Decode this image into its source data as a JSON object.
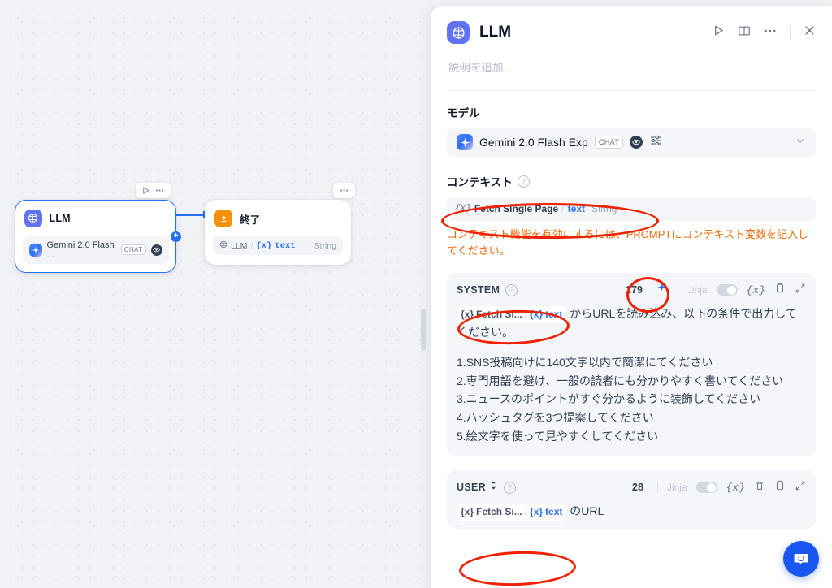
{
  "canvas": {
    "node_toolbar_llm": {
      "run_icon": "play-icon",
      "more_icon": "ellipsis-icon"
    },
    "node_toolbar_end": {
      "more_icon": "ellipsis-icon"
    },
    "nodes": [
      {
        "id": "llm",
        "title": "LLM",
        "badge_icon": "llm-node-icon",
        "selected": true,
        "model": {
          "name": "Gemini 2.0 Flash ...",
          "tag": "CHAT",
          "vision_icon": "eye-icon"
        }
      },
      {
        "id": "end",
        "title": "終了",
        "badge_icon": "end-node-icon",
        "selected": false,
        "variable": {
          "source_icon": "llm-inline-icon",
          "source": "LLM",
          "separator": "/",
          "var_prefix": "{x}",
          "var_name": "text",
          "type": "String"
        }
      }
    ]
  },
  "panel": {
    "header": {
      "badge_icon": "llm-node-icon",
      "title": "LLM",
      "actions": [
        {
          "name": "run-icon",
          "glyph": "play"
        },
        {
          "name": "help-book-icon",
          "glyph": "book"
        },
        {
          "name": "more-icon",
          "glyph": "ellipsis"
        },
        {
          "name": "close-icon",
          "glyph": "close"
        }
      ]
    },
    "description_placeholder": "説明を追加...",
    "model_section": {
      "label": "モデル",
      "provider_icon": "gemini-icon",
      "model_name": "Gemini 2.0 Flash Exp",
      "tag": "CHAT",
      "vision_icon": "eye-icon",
      "params_icon": "sliders-icon",
      "chevron_icon": "chevron-down-icon"
    },
    "context_section": {
      "label": "コンテキスト",
      "help_icon": "question-icon",
      "variable": {
        "prefix": "{x}",
        "node_name": "Fetch Single Page",
        "separator": "/",
        "var_name": "text",
        "type": "String"
      },
      "warning": "コンテキスト機能を有効にするには、PROMPTにコンテキスト変数を記入してください。"
    },
    "prompts": [
      {
        "role": "SYSTEM",
        "help_icon": "question-icon",
        "char_count": "179",
        "generate_icon": "sparkle-icon",
        "jinja_label": "Jinja",
        "jinja_on": false,
        "tools": [
          "variable-icon",
          "copy-icon",
          "expand-icon"
        ],
        "variable": {
          "prefix": "{x}",
          "node_name": "Fetch Si...",
          "separator": "/",
          "var_prefix": "{x}",
          "var_name": "text"
        },
        "text_after_pill": " からURLを読み込み、以下の条件で出力してください。",
        "lines": [
          "1.SNS投稿向けに140文字以内で簡潔にてください",
          "2.専門用語を避け、一般の読者にも分かりやすく書いてください",
          "3.ニュースのポイントがすぐ分かるように装飾してください",
          "4.ハッシュタグを3つ提案してください",
          "5.絵文字を使って見やすくしてください"
        ]
      },
      {
        "role": "USER",
        "role_sort_icon": "sort-icon",
        "help_icon": "question-icon",
        "char_count": "28",
        "jinja_label": "Jinja",
        "jinja_on": false,
        "tools": [
          "variable-icon",
          "delete-icon",
          "copy-icon",
          "expand-icon"
        ],
        "variable": {
          "prefix": "{x}",
          "node_name": "Fetch Si...",
          "separator": "/",
          "var_prefix": "{x}",
          "var_name": "text"
        },
        "text_after_pill": " のURL",
        "lines": []
      }
    ]
  },
  "fab": {
    "icon": "chat-smiley-icon"
  },
  "colors": {
    "accent_blue": "#2970ff",
    "node_llm": "#6172f3",
    "node_end": "#f79009",
    "warning": "#f0690b",
    "annotation": "#ee2200",
    "fab": "#1a56f0"
  }
}
